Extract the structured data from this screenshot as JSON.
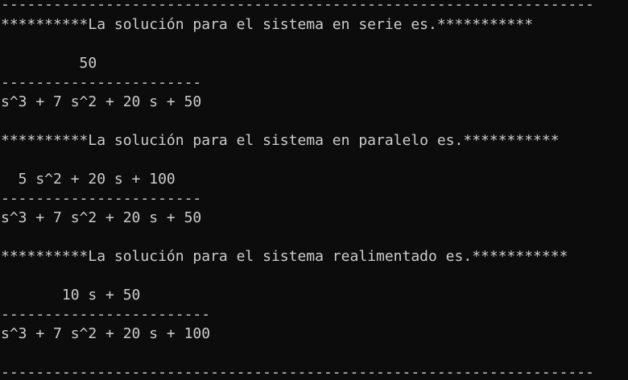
{
  "console": {
    "top_rule": "--------------------------------------------------------------------",
    "serie": {
      "header": "**********La solución para el sistema en serie es.***********",
      "numerator": "         50",
      "bar": "-----------------------",
      "denominator": "s^3 + 7 s^2 + 20 s + 50"
    },
    "paralelo": {
      "header": "**********La solución para el sistema en paralelo es.***********",
      "numerator": "  5 s^2 + 20 s + 100",
      "bar": "-----------------------",
      "denominator": "s^3 + 7 s^2 + 20 s + 50"
    },
    "realimentado": {
      "header": "**********La solución para el sistema realimentado es.***********",
      "numerator": "       10 s + 50",
      "bar": "------------------------",
      "denominator": "s^3 + 7 s^2 + 20 s + 100"
    },
    "bottom_rule": "--------------------------------------------------------------------"
  }
}
